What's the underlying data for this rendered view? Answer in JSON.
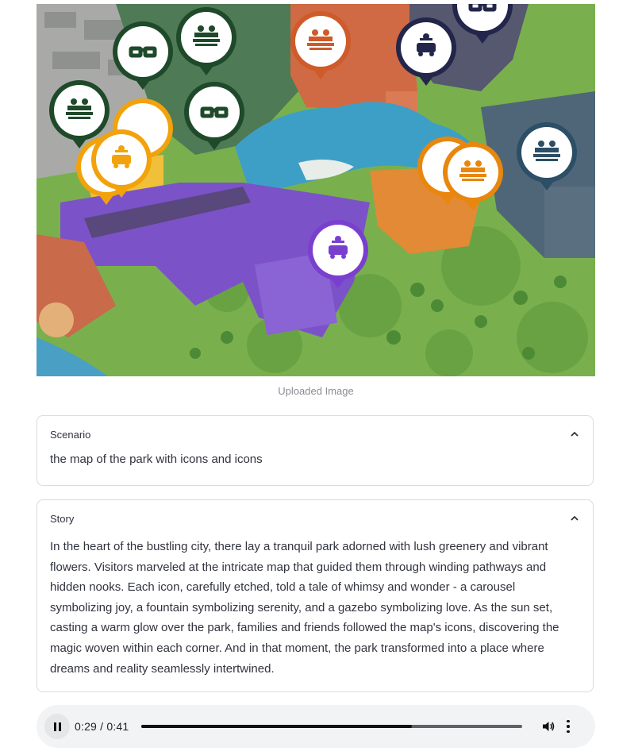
{
  "image": {
    "caption": "Uploaded Image",
    "markers": [
      {
        "icon": "glasses-icon",
        "color": "#1f4a2a"
      },
      {
        "icon": "ride-seats-icon",
        "color": "#1f4a2a"
      },
      {
        "icon": "ride-seats-icon",
        "color": "#1f4a2a"
      },
      {
        "icon": "glasses-icon",
        "color": "#1f4a2a"
      },
      {
        "icon": "ride-car-icon",
        "color": "#f2a20b"
      },
      {
        "icon": "ride-car-icon",
        "color": "#f2a20b"
      },
      {
        "icon": "ride-seats-icon",
        "color": "#cf5a2a"
      },
      {
        "icon": "ride-car-icon",
        "color": "#23264a"
      },
      {
        "icon": "glasses-icon",
        "color": "#23264a"
      },
      {
        "icon": "ride-car-icon",
        "color": "#e8860e"
      },
      {
        "icon": "ride-seats-icon",
        "color": "#e8860e"
      },
      {
        "icon": "ride-seats-icon",
        "color": "#2c4e66"
      },
      {
        "icon": "ride-car-icon",
        "color": "#7a3fcf"
      }
    ]
  },
  "scenario": {
    "title": "Scenario",
    "text": "the map of the park with icons and icons"
  },
  "story": {
    "title": "Story",
    "text": "In the heart of the bustling city, there lay a tranquil park adorned with lush greenery and vibrant flowers. Visitors marveled at the intricate map that guided them through winding pathways and hidden nooks. Each icon, carefully etched, told a tale of whimsy and wonder - a carousel symbolizing joy, a fountain symbolizing serenity, and a gazebo symbolizing love. As the sun set, casting a warm glow over the park, families and friends followed the map's icons, discovering the magic woven within each corner. And in that moment, the park transformed into a place where dreams and reality seamlessly intertwined."
  },
  "audio": {
    "current_time": "0:29",
    "separator": "/",
    "duration": "0:41",
    "progress": 0.71,
    "state": "playing"
  }
}
